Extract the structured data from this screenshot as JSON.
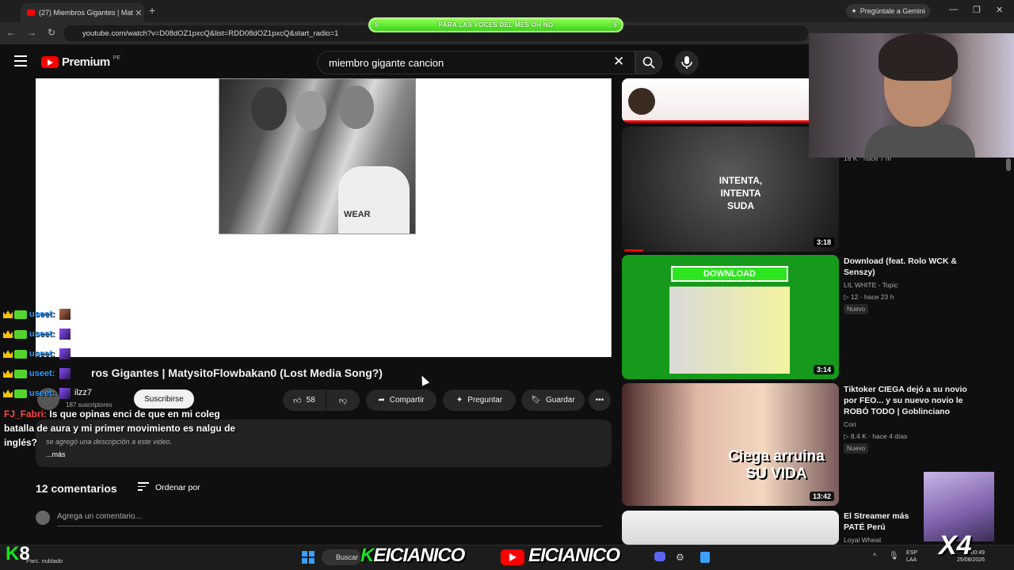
{
  "browser": {
    "tab_title": "(27) Miembros Gigantes | Maty",
    "url": "youtube.com/watch?v=D08dOZ1pxcQ&list=RDD08dOZ1pxcQ&start_radio=1",
    "gemini_label": "Pregúntale a Gemini"
  },
  "stream_banner": {
    "text": "PARA LAS VOCES DEL MES OH NO",
    "left_num": "5",
    "right_num": "5"
  },
  "youtube": {
    "logo_text": "Premium",
    "country": "PE",
    "search_query": "miembro gigante cancion"
  },
  "video": {
    "title": "ros Gigantes | MatysitoFlowbakan0 (Lost Media Song?)",
    "photo_text": "WEAR",
    "channel": "ilzz7",
    "subscribers": "187 suscriptores",
    "subscribe_label": "Suscribirse",
    "likes": "58",
    "share_label": "Compartir",
    "ask_label": "Preguntar",
    "save_label": "Guardar",
    "description": "se agregó una descripción a este video.",
    "more_label": "...más",
    "comments_count": "12 comentarios",
    "sort_label": "Ordenar por",
    "comment_placeholder": "Agrega un comentario..."
  },
  "chat": {
    "rows": [
      "useet:",
      "useet:",
      "useet:",
      "useet:",
      "useet:"
    ],
    "message_user": "FJ_Fabri:",
    "message_text": "Is que opinas enci de que en mi coleg batalla de aura y mi primer movimiento es nalgu de inglés?"
  },
  "sidebar": {
    "items": [
      {
        "duration": "",
        "title": "",
        "meta1": "18 K · hace 7 m",
        "meta2": ""
      },
      {
        "duration": "3:18",
        "thumb_text": "INTENTA, INTENTA SUDA",
        "title": "",
        "meta1": "",
        "meta2": ""
      },
      {
        "duration": "3:14",
        "thumb_text": "DOWNLOAD",
        "title": "Download (feat. Rolo WCK & Senszy)",
        "meta1": "LIL WHITE - Topic",
        "meta2": "▷ 12 · hace 23 h",
        "badge": "Nuevo"
      },
      {
        "duration": "13:42",
        "thumb_text": "Ciega arruina SU VIDA",
        "title": "Tiktoker CIEGA dejó a su novio por FEO... y su nuevo novio le ROBÓ TODO | Goblinciano",
        "meta1": "Cori",
        "meta2": "▷ 8.4 K · hace 4 días",
        "badge": "Nuevo"
      },
      {
        "duration": "",
        "title": "El Streamer más PATÉ Perú",
        "meta1": "Loyal Wheat",
        "meta2": ""
      }
    ]
  },
  "taskbar": {
    "overlay_number": "8",
    "weather": "Parc. nublado",
    "search_label": "Buscar",
    "streamer_name_1": "EICIANICO",
    "streamer_name_2": "EICIANICO",
    "lang_1": "ESP",
    "lang_2": "LAA",
    "time": "00:49",
    "date": "25/08/2026",
    "overlay_x4": "X4"
  }
}
